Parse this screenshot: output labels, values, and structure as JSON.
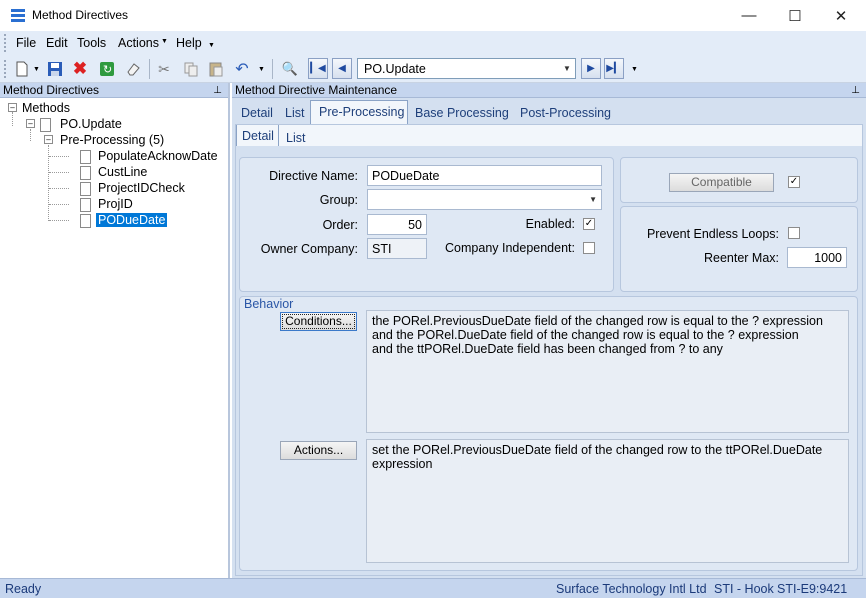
{
  "window": {
    "title": "Method Directives",
    "minimize_icon": "minimize-icon",
    "maximize_icon": "maximize-icon",
    "close_icon": "close-icon"
  },
  "menu": {
    "file": "File",
    "edit": "Edit",
    "tools": "Tools",
    "actions": "Actions",
    "help": "Help"
  },
  "toolbar": {
    "nav_value": "PO.Update"
  },
  "left_panel": {
    "title": "Method Directives",
    "tree": {
      "root": "Methods",
      "method": "PO.Update",
      "group": "Pre-Processing (5)",
      "items": [
        "PopulateAcknowDate",
        "CustLine",
        "ProjectIDCheck",
        "ProjID",
        "PODueDate"
      ]
    }
  },
  "right_panel": {
    "title": "Method Directive Maintenance",
    "tabs": [
      "Detail",
      "List",
      "Pre-Processing",
      "Base Processing",
      "Post-Processing"
    ],
    "subtabs": [
      "Detail",
      "List"
    ],
    "form": {
      "directive_name_label": "Directive Name:",
      "directive_name": "PODueDate",
      "group_label": "Group:",
      "group_value": "",
      "order_label": "Order:",
      "order": "50",
      "enabled_label": "Enabled:",
      "enabled": true,
      "owner_company_label": "Owner Company:",
      "owner_company": "STI",
      "company_independent_label": "Company Independent:",
      "company_independent": false,
      "compatible_button": "Compatible",
      "compatible_checked": true,
      "prevent_loops_label": "Prevent Endless Loops:",
      "prevent_loops": false,
      "reenter_max_label": "Reenter Max:",
      "reenter_max": "1000"
    },
    "behavior": {
      "title": "Behavior",
      "conditions_button": "Conditions...",
      "conditions_lines": [
        "the PORel.PreviousDueDate field of the changed row is equal to the  ?  expression",
        "and the PORel.DueDate field of the changed row is equal to the  ?  expression",
        "and the ttPORel.DueDate field has been changed from ? to any"
      ],
      "actions_button": "Actions...",
      "actions_lines": [
        "set the PORel.PreviousDueDate field of the changed row to the ttPORel.DueDate",
        "expression"
      ]
    }
  },
  "status": {
    "left": "Ready",
    "company": "Surface Technology Intl Ltd",
    "site": "STI - Hook",
    "server": "STI-E9:9421"
  }
}
